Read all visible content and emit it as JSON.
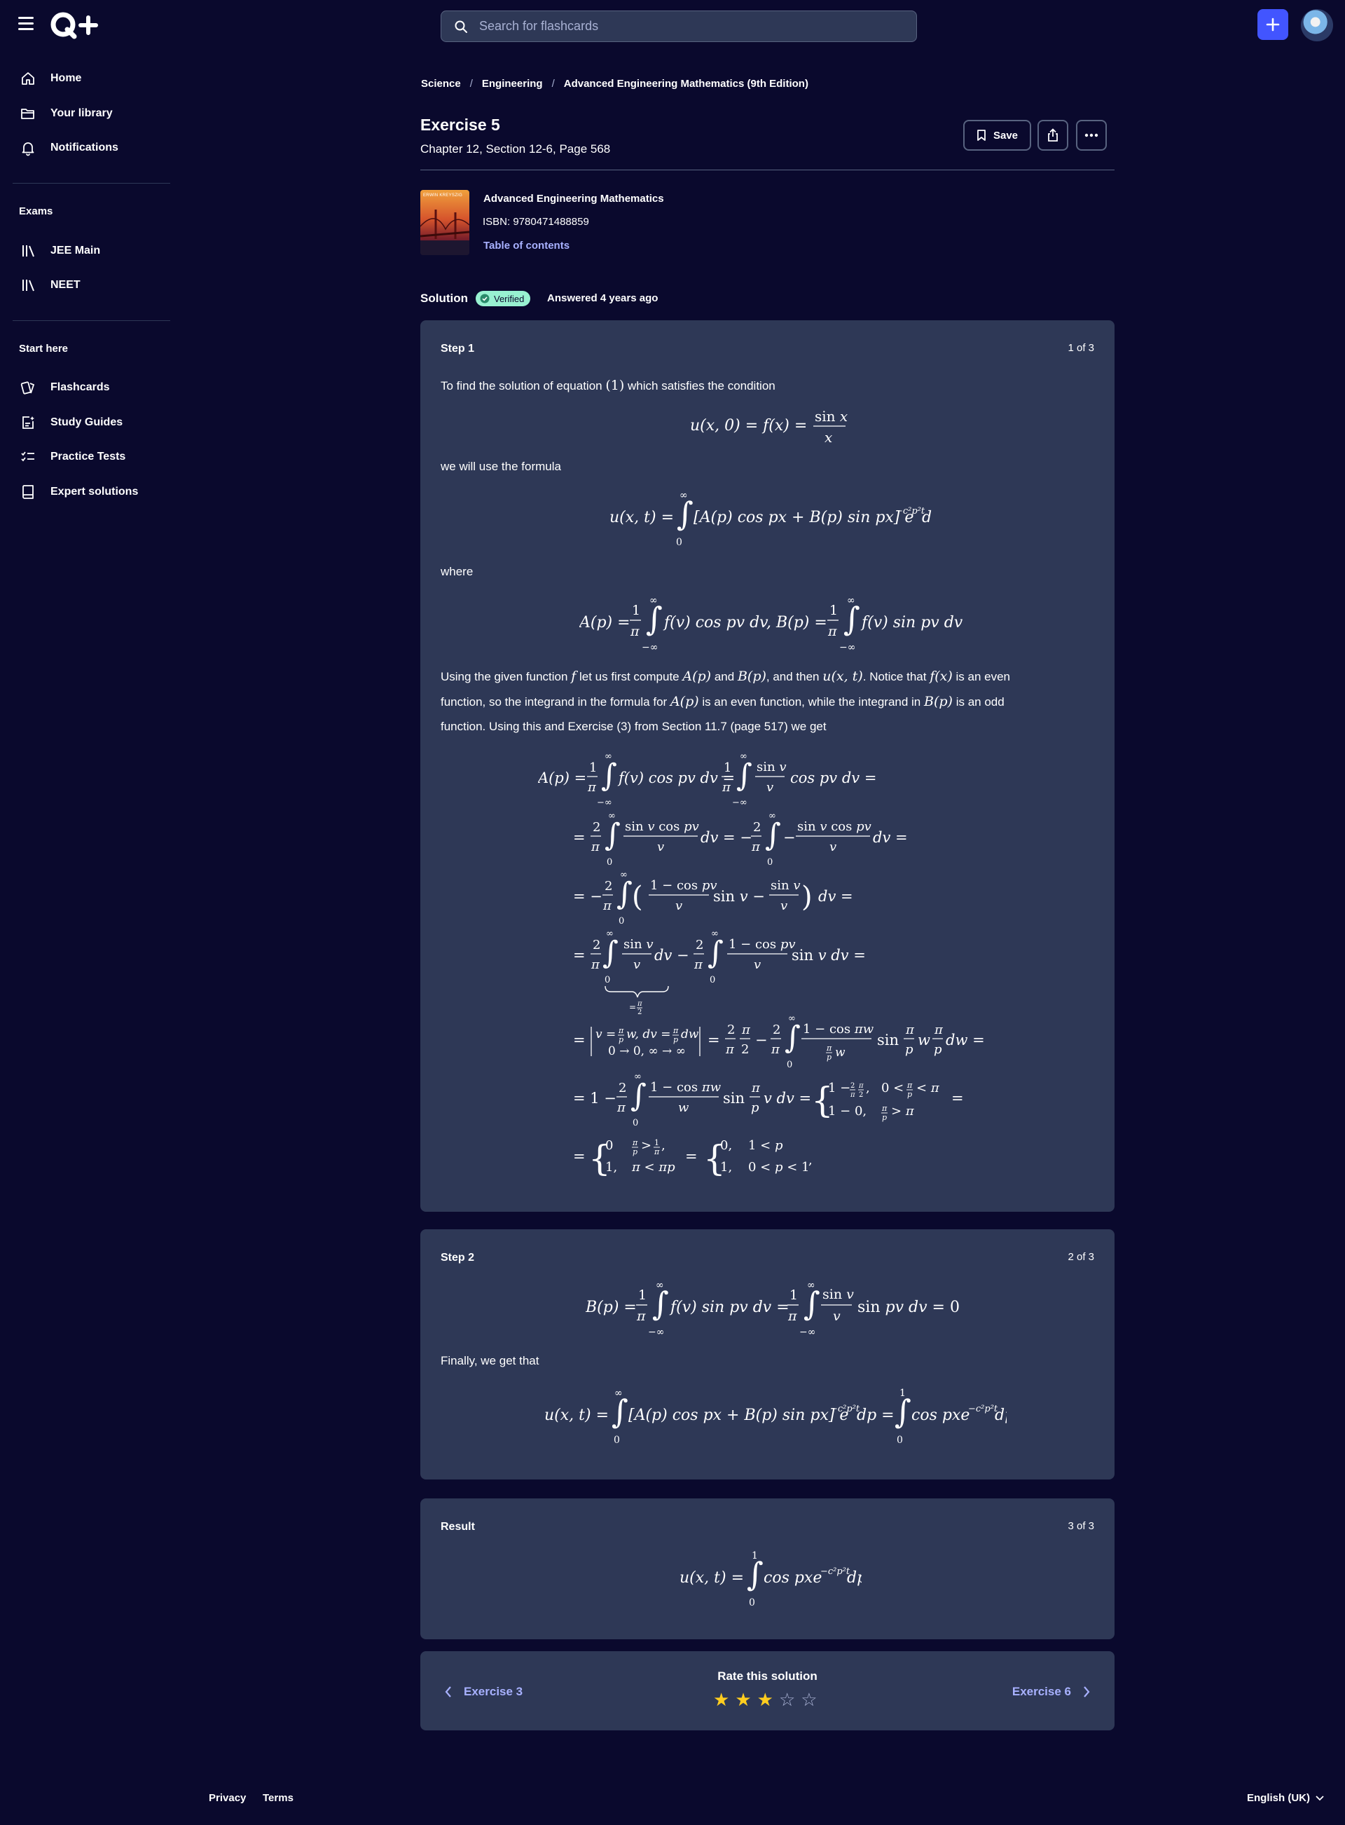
{
  "header": {
    "search_placeholder": "Search for flashcards"
  },
  "sidebar": {
    "items": [
      {
        "label": "Home",
        "icon": "home-icon"
      },
      {
        "label": "Your library",
        "icon": "folder-icon"
      },
      {
        "label": "Notifications",
        "icon": "bell-icon"
      }
    ],
    "exams_title": "Exams",
    "exams": [
      {
        "label": "JEE Main",
        "icon": "library-icon"
      },
      {
        "label": "NEET",
        "icon": "library-icon"
      }
    ],
    "start_title": "Start here",
    "start": [
      {
        "label": "Flashcards",
        "icon": "cards-icon"
      },
      {
        "label": "Study Guides",
        "icon": "guide-icon"
      },
      {
        "label": "Practice Tests",
        "icon": "checklist-icon"
      },
      {
        "label": "Expert solutions",
        "icon": "book-icon"
      }
    ]
  },
  "breadcrumb": [
    "Science",
    "Engineering",
    "Advanced Engineering Mathematics (9th Edition)"
  ],
  "exercise": {
    "title": "Exercise 5",
    "subtitle": "Chapter 12, Section 12-6, Page 568",
    "save_label": "Save"
  },
  "book": {
    "title": "Advanced Engineering Mathematics",
    "isbn": "ISBN: 9780471488859",
    "toc": "Table of contents",
    "cover_text": "ERWIN KREYSZIG"
  },
  "solution": {
    "label": "Solution",
    "verified": "Verified",
    "answered": "Answered 4 years ago"
  },
  "steps": [
    {
      "title": "Step 1",
      "count": "1 of 3",
      "text1": "To find the solution of equation",
      "text1b": "which satisfies the condition",
      "text2": "we will use the formula",
      "text3": "where",
      "text4a": "Using the given function",
      "text4b": "let us first compute",
      "text4c": "and",
      "text4d": ", and then",
      "text4e": ". Notice that",
      "text4f": "is an even",
      "text5a": "function, so the integrand in the formula for",
      "text5b": "is an even function, while the integrand in",
      "text5c": "is an odd",
      "text6": "function. Using this and Exercise (3) from Section 11.7 (page 517) we get"
    },
    {
      "title": "Step 2",
      "count": "2 of 3",
      "text1": "Finally, we get that"
    },
    {
      "title": "Result",
      "count": "3 of 3"
    }
  ],
  "rating": {
    "title": "Rate this solution",
    "value": 3,
    "max": 5,
    "prev": "Exercise 3",
    "next": "Exercise 6"
  },
  "footer": {
    "privacy": "Privacy",
    "terms": "Terms",
    "language": "English (UK)"
  },
  "colors": {
    "background": "#0a092d",
    "card": "#2e3856",
    "accent": "#4255ff",
    "link": "#a8b1ff",
    "star": "#ffcd1f",
    "verified": "#98f1d1"
  }
}
